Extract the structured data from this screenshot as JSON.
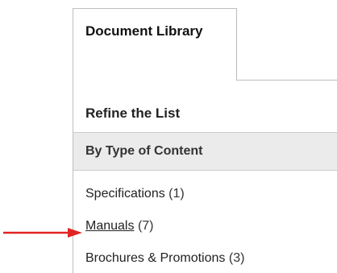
{
  "tab": {
    "title": "Document Library"
  },
  "sidebar": {
    "refine_title": "Refine the List",
    "section_header": "By Type of Content",
    "items": [
      {
        "label": "Specifications",
        "count": "(1)"
      },
      {
        "label": "Manuals",
        "count": "(7)"
      },
      {
        "label": "Brochures & Promotions",
        "count": "(3)"
      }
    ]
  },
  "colors": {
    "arrow": "#e02424",
    "header_bg": "#ebebeb",
    "border": "#bdbdbd"
  },
  "icons": [
    "arrow-pointer-icon"
  ]
}
